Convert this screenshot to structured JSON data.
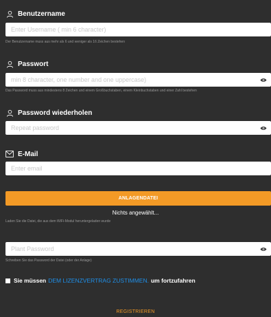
{
  "username": {
    "label": "Benutzername",
    "placeholder": "Enter Username ( min 6 character)",
    "hint": "Der Benutzername muss aus mehr als 6 und weniger als 16 Zeichen bestehen",
    "icon": "user-icon"
  },
  "password": {
    "label": "Passwort",
    "placeholder": "min 8 character, one number and one uppercase)",
    "hint": "Das Password muss aus mindestens 8 Zeichen und einem Großbuchstaben, einem Kleinbuchstaben und einer Zahl bestehen",
    "icon": "user-icon"
  },
  "password_repeat": {
    "label": "Password wiederholen",
    "placeholder": "Repeat password",
    "icon": "user-icon"
  },
  "email": {
    "label": "E-Mail",
    "placeholder": "Enter email",
    "icon": "envelope-icon"
  },
  "upload": {
    "button_label": "ANLAGENDATEI",
    "status": "Nichts angewählt...",
    "hint": "Laden Sie die Datei, die aus dem WiFi-Modul heruntergeladen wurde"
  },
  "plant_password": {
    "placeholder": "Plant Password",
    "hint": "Schreiben Sie das Password der Datei (oder der Anlage)"
  },
  "consent": {
    "prefix": "Sie müssen",
    "link": "DEM LIZENZVERTRAG ZUSTIMMEN.",
    "suffix": "um fortzufahren"
  },
  "register_label": "REGISTRIEREN",
  "colors": {
    "background": "#2e2e2e",
    "accent": "#f39a26",
    "link": "#1f8fe8"
  }
}
